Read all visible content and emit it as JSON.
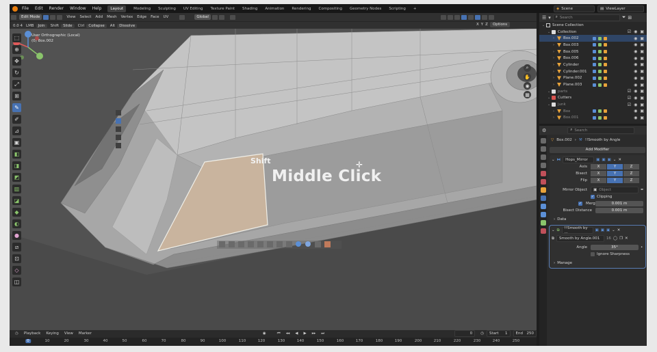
{
  "menu": {
    "items": [
      "File",
      "Edit",
      "Render",
      "Window",
      "Help"
    ],
    "workspaces": [
      "Layout",
      "Modeling",
      "Sculpting",
      "UV Editing",
      "Texture Paint",
      "Shading",
      "Animation",
      "Rendering",
      "Compositing",
      "Geometry Nodes",
      "Scripting"
    ],
    "active_workspace": "Layout",
    "add_tab": "+",
    "scene": "Scene",
    "view_layer": "ViewLayer"
  },
  "viewport_header": {
    "mode": "Edit Mode",
    "menus": [
      "View",
      "Select",
      "Add",
      "Mesh",
      "Vertex",
      "Edge",
      "Face",
      "UV"
    ],
    "transform_orientation": "Global",
    "options": "Options",
    "axes": [
      "X",
      "Y",
      "Z"
    ]
  },
  "toolsettings": {
    "items": [
      "0.0 4",
      "LMB",
      "Join",
      "Shift",
      "Slide",
      "Ctrl",
      "Collapse",
      "Alt",
      "Dissolve"
    ]
  },
  "viewport": {
    "view_name": "User Orthographic (Local)",
    "object": "(0) Box.002",
    "hint_modifier": "Shift",
    "hint_action": "Middle Click"
  },
  "timeline": {
    "menus": [
      "Playback",
      "Keying",
      "View",
      "Marker"
    ],
    "current_frame": "0",
    "start_label": "Start",
    "start": "1",
    "end_label": "End",
    "end": "250",
    "ruler": [
      "0",
      "10",
      "20",
      "30",
      "40",
      "50",
      "60",
      "70",
      "80",
      "90",
      "100",
      "110",
      "120",
      "130",
      "140",
      "150",
      "160",
      "170",
      "180",
      "190",
      "200",
      "210",
      "220",
      "230",
      "240",
      "250"
    ]
  },
  "outliner": {
    "search_placeholder": "Search",
    "rows": [
      {
        "label": "Scene Collection",
        "indent": 0,
        "type": "scene",
        "selected": false,
        "dim": false
      },
      {
        "label": "Collection",
        "indent": 1,
        "type": "collection",
        "selected": false,
        "dim": false
      },
      {
        "label": "Box.002",
        "indent": 2,
        "type": "mesh",
        "selected": true,
        "dim": false
      },
      {
        "label": "Box.003",
        "indent": 2,
        "type": "mesh",
        "selected": false,
        "dim": false
      },
      {
        "label": "Box.005",
        "indent": 2,
        "type": "mesh",
        "selected": false,
        "dim": false
      },
      {
        "label": "Box.006",
        "indent": 2,
        "type": "mesh",
        "selected": false,
        "dim": false
      },
      {
        "label": "Cylinder",
        "indent": 2,
        "type": "mesh",
        "selected": false,
        "dim": false
      },
      {
        "label": "Cylinder.001",
        "indent": 2,
        "type": "mesh",
        "selected": false,
        "dim": false
      },
      {
        "label": "Plane.002",
        "indent": 2,
        "type": "mesh",
        "selected": false,
        "dim": false
      },
      {
        "label": "Plane.003",
        "indent": 2,
        "type": "mesh",
        "selected": false,
        "dim": false
      },
      {
        "label": "parts",
        "indent": 1,
        "type": "collection",
        "selected": false,
        "dim": true
      },
      {
        "label": "Cutters",
        "indent": 1,
        "type": "collection-red",
        "selected": false,
        "dim": false
      },
      {
        "label": "junk",
        "indent": 1,
        "type": "collection",
        "selected": false,
        "dim": true
      },
      {
        "label": "Box",
        "indent": 2,
        "type": "mesh",
        "selected": false,
        "dim": true
      },
      {
        "label": "Box.001",
        "indent": 2,
        "type": "mesh",
        "selected": false,
        "dim": true
      }
    ]
  },
  "properties": {
    "search_placeholder": "Search",
    "object_name": "Box.002",
    "modifier_breadcrumb": "!!Smooth by Angle",
    "add_modifier": "Add Modifier",
    "mirror": {
      "name": "Hops_Mirror",
      "axis_label": "Axis",
      "bisect_label": "Bisect",
      "flip_label": "Flip",
      "axes": [
        "X",
        "Y",
        "Z"
      ],
      "mirror_object_label": "Mirror Object",
      "mirror_object_placeholder": "Object",
      "clipping": "Clipping",
      "merge_label": "Merge",
      "merge_value": "0.001 m",
      "bisect_distance_label": "Bisect Distance",
      "bisect_distance_value": "0.001 m",
      "data_label": "Data"
    },
    "smooth": {
      "name": "!!Smooth by ...",
      "node_group": "Smooth by Angle.001",
      "users": "16",
      "angle_label": "Angle",
      "angle_value": "35°",
      "ignore_sharpness": "Ignore Sharpness",
      "manage": "Manage"
    }
  },
  "colors": {
    "accent": "#4772b3",
    "mesh_orange": "#e8a33a",
    "selected_face": "#c9b49e",
    "viewport_bg": "#545454",
    "mesh_grey": "#a9a9a9"
  }
}
